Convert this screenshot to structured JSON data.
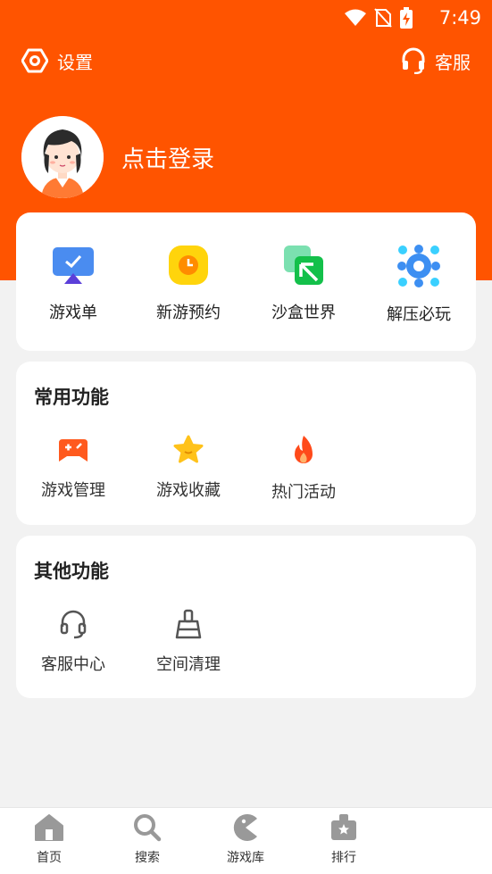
{
  "status_bar": {
    "time": "7:49"
  },
  "top_bar": {
    "settings_label": "设置",
    "support_label": "客服"
  },
  "profile": {
    "login_text": "点击登录"
  },
  "quick_actions": [
    {
      "label": "游戏单",
      "icon": "game-list-icon"
    },
    {
      "label": "新游预约",
      "icon": "clock-icon"
    },
    {
      "label": "沙盒世界",
      "icon": "sandbox-icon"
    },
    {
      "label": "解压必玩",
      "icon": "dots-icon"
    }
  ],
  "common_functions": {
    "title": "常用功能",
    "items": [
      {
        "label": "游戏管理",
        "icon": "gamepad-icon"
      },
      {
        "label": "游戏收藏",
        "icon": "star-icon"
      },
      {
        "label": "热门活动",
        "icon": "fire-icon"
      }
    ]
  },
  "other_functions": {
    "title": "其他功能",
    "items": [
      {
        "label": "客服中心",
        "icon": "headset-icon"
      },
      {
        "label": "空间清理",
        "icon": "broom-icon"
      }
    ]
  },
  "bottom_nav": [
    {
      "label": "首页",
      "icon": "home-icon"
    },
    {
      "label": "搜索",
      "icon": "search-icon"
    },
    {
      "label": "游戏库",
      "icon": "pacman-icon"
    },
    {
      "label": "排行",
      "icon": "ranking-icon"
    }
  ],
  "colors": {
    "accent": "#ff5400",
    "background": "#f2f2f2"
  }
}
